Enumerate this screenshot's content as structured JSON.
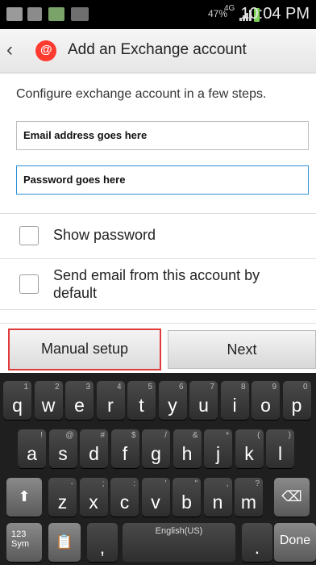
{
  "status_bar": {
    "network": "4G",
    "battery": "47%",
    "time": "10:04 PM"
  },
  "action_bar": {
    "title": "Add an Exchange account"
  },
  "form": {
    "intro": "Configure exchange account in a few steps.",
    "email_value": "Email address goes here",
    "password_value": "Password goes here",
    "show_password_label": "Show password",
    "send_default_label": "Send email from this account by default"
  },
  "buttons": {
    "manual_setup": "Manual setup",
    "next": "Next"
  },
  "keyboard": {
    "row1": [
      {
        "m": "q",
        "s": "1"
      },
      {
        "m": "w",
        "s": "2"
      },
      {
        "m": "e",
        "s": "3"
      },
      {
        "m": "r",
        "s": "4"
      },
      {
        "m": "t",
        "s": "5"
      },
      {
        "m": "y",
        "s": "6"
      },
      {
        "m": "u",
        "s": "7"
      },
      {
        "m": "i",
        "s": "8"
      },
      {
        "m": "o",
        "s": "9"
      },
      {
        "m": "p",
        "s": "0"
      }
    ],
    "row2": [
      {
        "m": "a",
        "s": "!"
      },
      {
        "m": "s",
        "s": "@"
      },
      {
        "m": "d",
        "s": "#"
      },
      {
        "m": "f",
        "s": "$"
      },
      {
        "m": "g",
        "s": "/"
      },
      {
        "m": "h",
        "s": "&"
      },
      {
        "m": "j",
        "s": "*"
      },
      {
        "m": "k",
        "s": "("
      },
      {
        "m": "l",
        "s": ")"
      }
    ],
    "row3": [
      {
        "m": "z",
        "s": "-"
      },
      {
        "m": "x",
        "s": ";"
      },
      {
        "m": "c",
        "s": ":"
      },
      {
        "m": "v",
        "s": "'"
      },
      {
        "m": "b",
        "s": "\""
      },
      {
        "m": "n",
        "s": ","
      },
      {
        "m": "m",
        "s": "?"
      }
    ],
    "sym_label": "123\nSym",
    "comma_label": ",",
    "space_label": "English(US)",
    "period_label": ".",
    "done_label": "Done",
    "shift_icon": "shift-arrow",
    "delete_icon": "backspace"
  }
}
